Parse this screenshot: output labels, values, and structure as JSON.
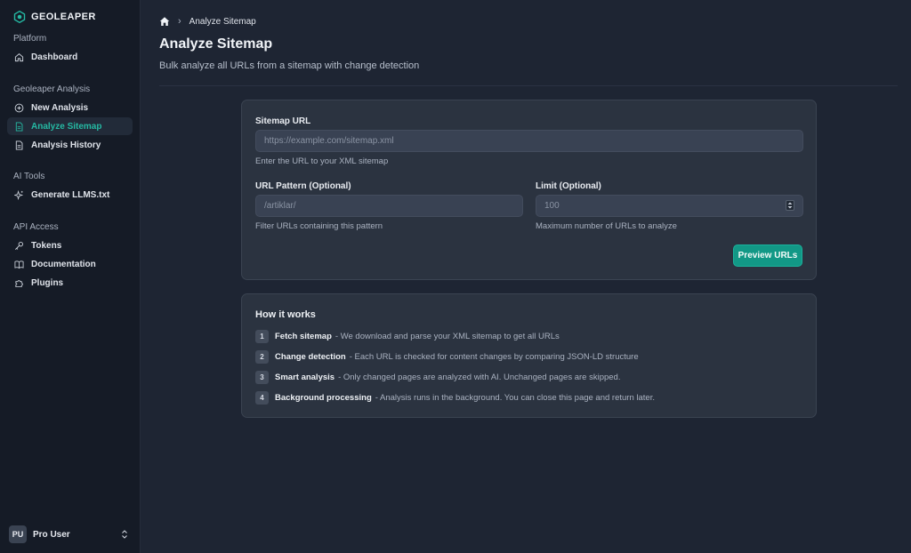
{
  "brand": {
    "name": "GEOLEAPER",
    "accent": "#25b9a3"
  },
  "sidebar": {
    "groups": [
      {
        "label": "Platform",
        "items": [
          {
            "label": "Dashboard",
            "icon": "home-icon"
          }
        ]
      },
      {
        "label": "Geoleaper Analysis",
        "items": [
          {
            "label": "New Analysis",
            "icon": "plus-circle-icon"
          },
          {
            "label": "Analyze Sitemap",
            "icon": "file-text-icon",
            "active": true
          },
          {
            "label": "Analysis History",
            "icon": "document-icon"
          }
        ]
      },
      {
        "label": "AI Tools",
        "items": [
          {
            "label": "Generate LLMS.txt",
            "icon": "sparkle-icon"
          }
        ]
      },
      {
        "label": "API Access",
        "items": [
          {
            "label": "Tokens",
            "icon": "key-icon"
          },
          {
            "label": "Documentation",
            "icon": "book-icon"
          },
          {
            "label": "Plugins",
            "icon": "puzzle-icon"
          }
        ]
      }
    ],
    "user": {
      "initials": "PU",
      "name": "Pro User"
    }
  },
  "breadcrumb": {
    "current": "Analyze Sitemap"
  },
  "page": {
    "title": "Analyze Sitemap",
    "subtitle": "Bulk analyze all URLs from a sitemap with change detection"
  },
  "form": {
    "sitemap": {
      "label": "Sitemap URL",
      "placeholder": "https://example.com/sitemap.xml",
      "help": "Enter the URL to your XML sitemap"
    },
    "pattern": {
      "label": "URL Pattern (Optional)",
      "placeholder": "/artiklar/",
      "help": "Filter URLs containing this pattern"
    },
    "limit": {
      "label": "Limit (Optional)",
      "placeholder": "100",
      "help": "Maximum number of URLs to analyze"
    },
    "submit_label": "Preview URLs"
  },
  "how_it_works": {
    "title": "How it works",
    "steps": [
      {
        "num": "1",
        "title": "Fetch sitemap",
        "desc": "- We download and parse your XML sitemap to get all URLs"
      },
      {
        "num": "2",
        "title": "Change detection",
        "desc": "- Each URL is checked for content changes by comparing JSON-LD structure"
      },
      {
        "num": "3",
        "title": "Smart analysis",
        "desc": "- Only changed pages are analyzed with AI. Unchanged pages are skipped."
      },
      {
        "num": "4",
        "title": "Background processing",
        "desc": "- Analysis runs in the background. You can close this page and return later."
      }
    ]
  }
}
